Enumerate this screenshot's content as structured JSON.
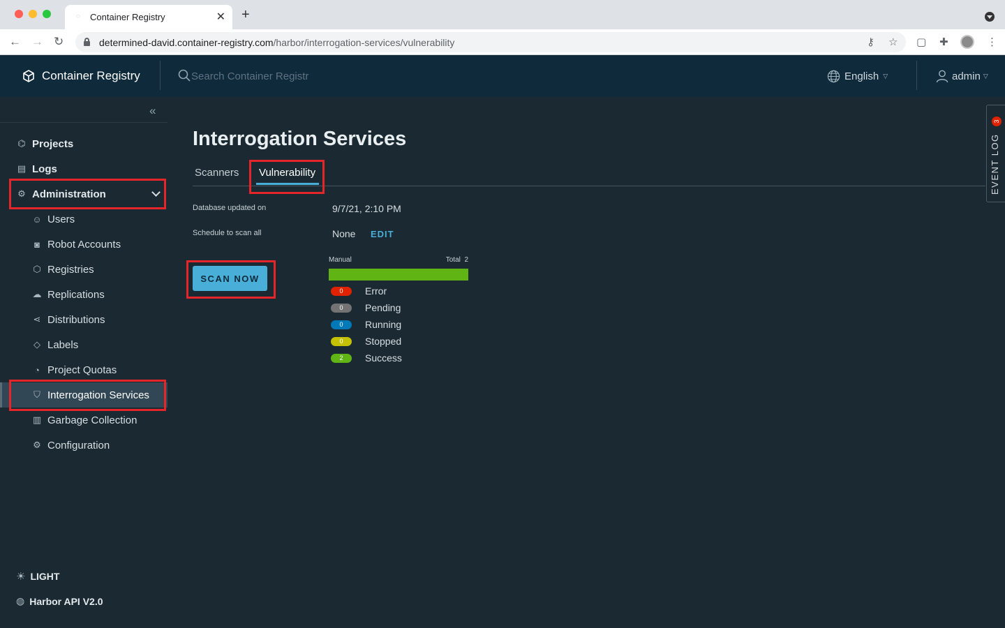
{
  "browser": {
    "tab_title": "Container Registry",
    "url_host": "determined-david.container-registry.com",
    "url_path": "/harbor/interrogation-services/vulnerability"
  },
  "header": {
    "brand": "Container Registry",
    "search_placeholder": "Search Container Registr",
    "language": "English",
    "user": "admin"
  },
  "sidebar": {
    "items": [
      {
        "label": "Projects",
        "icon": "projects-icon"
      },
      {
        "label": "Logs",
        "icon": "logs-icon"
      },
      {
        "label": "Administration",
        "icon": "administration-icon"
      }
    ],
    "admin_items": [
      {
        "label": "Users",
        "icon": "users-icon"
      },
      {
        "label": "Robot Accounts",
        "icon": "robot-icon"
      },
      {
        "label": "Registries",
        "icon": "registries-icon"
      },
      {
        "label": "Replications",
        "icon": "replications-icon"
      },
      {
        "label": "Distributions",
        "icon": "distributions-icon"
      },
      {
        "label": "Labels",
        "icon": "labels-icon"
      },
      {
        "label": "Project Quotas",
        "icon": "quotas-icon"
      },
      {
        "label": "Interrogation Services",
        "icon": "shield-icon"
      },
      {
        "label": "Garbage Collection",
        "icon": "trash-icon"
      },
      {
        "label": "Configuration",
        "icon": "gear-icon"
      }
    ],
    "theme_toggle": "LIGHT",
    "api_link": "Harbor API V2.0"
  },
  "main": {
    "title": "Interrogation Services",
    "tabs": [
      {
        "label": "Scanners"
      },
      {
        "label": "Vulnerability"
      }
    ],
    "db_updated_label": "Database updated on",
    "db_updated_value": "9/7/21, 2:10 PM",
    "schedule_label": "Schedule to scan all",
    "schedule_value": "None",
    "edit_label": "EDIT",
    "scan_now_label": "SCAN NOW"
  },
  "scan_stats": {
    "header_left": "Manual",
    "total_label": "Total",
    "total_value": "2",
    "success_fraction": 1.0,
    "statuses": [
      {
        "label": "Error",
        "count": "0",
        "color": "#e12200"
      },
      {
        "label": "Pending",
        "count": "0",
        "color": "#737373"
      },
      {
        "label": "Running",
        "count": "0",
        "color": "#0079b8"
      },
      {
        "label": "Stopped",
        "count": "0",
        "color": "#c5c000"
      },
      {
        "label": "Success",
        "count": "2",
        "color": "#60b515"
      }
    ]
  },
  "event_log": {
    "label": "EVENT LOG",
    "count": "3"
  }
}
